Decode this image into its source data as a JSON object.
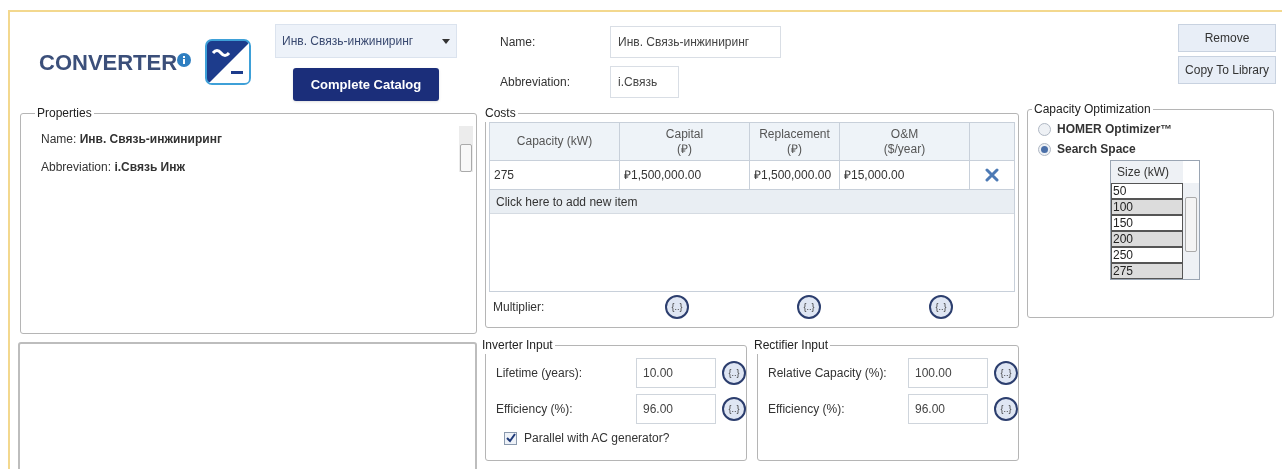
{
  "header": {
    "logo_text": "CONVERTER",
    "dropdown": {
      "value": "Инв. Связь-инжиниринг"
    },
    "catalog_button": "Complete Catalog",
    "fields": [
      {
        "label": "Name:",
        "value": "Инв. Связь-инжиниринг"
      },
      {
        "label": "Abbreviation:",
        "value": "i.Связь"
      }
    ],
    "buttons": [
      "Remove",
      "Copy To Library"
    ]
  },
  "properties": {
    "title": "Properties",
    "items": [
      {
        "label": "Name:",
        "value": "Инв. Связь-инжиниринг"
      },
      {
        "label": "Abbreviation:",
        "value": "i.Связь Инж"
      }
    ]
  },
  "costs": {
    "title": "Costs",
    "columns": [
      {
        "label": "Capacity (kW)"
      },
      {
        "label": "Capital",
        "unit": "(₽)"
      },
      {
        "label": "Replacement",
        "unit": "(₽)"
      },
      {
        "label": "O&M",
        "unit": "($/year)"
      }
    ],
    "rows": [
      [
        "275",
        "₽1,500,000.00",
        "₽1,500,000.00",
        "₽15,000.00"
      ]
    ],
    "add_row": "Click here to add new item",
    "multiplier_label": "Multiplier:",
    "multipliers": [
      "{..}",
      "{..}",
      "{..}"
    ]
  },
  "capacity_optimization": {
    "title": "Capacity Optimization",
    "options": [
      {
        "label": "HOMER Optimizer™",
        "selected": false
      },
      {
        "label": "Search Space",
        "selected": true
      }
    ],
    "size_table": {
      "header": "Size (kW)",
      "values": [
        "50",
        "100",
        "150",
        "200",
        "250",
        "275"
      ]
    }
  },
  "inverter_input": {
    "title": "Inverter Input",
    "fields": [
      {
        "label": "Lifetime (years):",
        "value": "10.00",
        "sensitivity": "{..}"
      },
      {
        "label": "Efficiency (%):",
        "value": "96.00",
        "sensitivity": "{..}"
      }
    ],
    "checkbox": {
      "label": "Parallel with AC generator?",
      "checked": true
    }
  },
  "rectifier_input": {
    "title": "Rectifier Input",
    "fields": [
      {
        "label": "Relative Capacity (%):",
        "value": "100.00",
        "sensitivity": "{..}"
      },
      {
        "label": "Efficiency (%):",
        "value": "96.00",
        "sensitivity": "{..}"
      }
    ]
  }
}
